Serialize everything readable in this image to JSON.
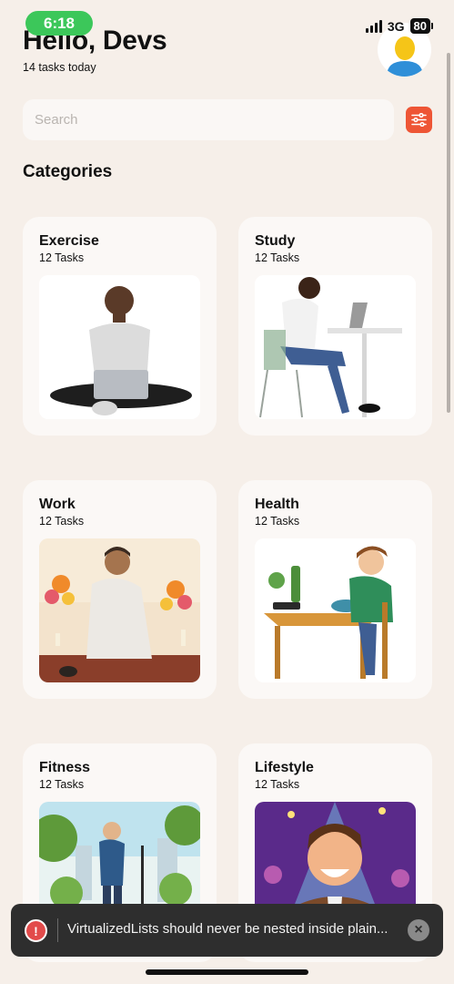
{
  "status_bar": {
    "time": "6:18",
    "network": "3G",
    "battery": "80"
  },
  "header": {
    "greeting": "Hello, Devs",
    "subtitle": "14 tasks today"
  },
  "search": {
    "placeholder": "Search"
  },
  "section": {
    "title": "Categories"
  },
  "categories": [
    {
      "title": "Exercise",
      "count": "12 Tasks"
    },
    {
      "title": "Study",
      "count": "12 Tasks"
    },
    {
      "title": "Work",
      "count": "12 Tasks"
    },
    {
      "title": "Health",
      "count": "12 Tasks"
    },
    {
      "title": "Fitness",
      "count": "12 Tasks"
    },
    {
      "title": "Lifestyle",
      "count": "12 Tasks"
    }
  ],
  "toast": {
    "message": "VirtualizedLists should never be nested inside plain...",
    "icon": "!",
    "close_icon": "×"
  },
  "colors": {
    "background": "#F6EFE9",
    "card": "#FBF8F6",
    "accent": "#EE5535",
    "time_pill": "#3CC75A",
    "toast": "#2E2E2E"
  }
}
